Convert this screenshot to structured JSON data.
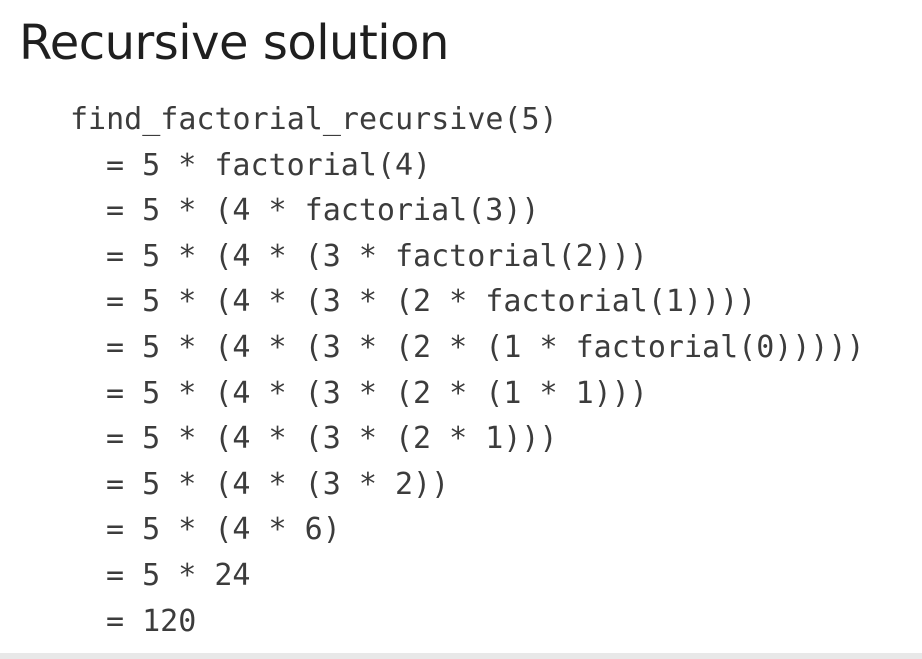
{
  "title": "Recursive solution",
  "code": {
    "call": "find_factorial_recursive(5)",
    "steps": [
      "= 5 * factorial(4)",
      "= 5 * (4 * factorial(3))",
      "= 5 * (4 * (3 * factorial(2)))",
      "= 5 * (4 * (3 * (2 * factorial(1))))",
      "= 5 * (4 * (3 * (2 * (1 * factorial(0)))))",
      "= 5 * (4 * (3 * (2 * (1 * 1)))",
      "= 5 * (4 * (3 * (2 * 1)))",
      "= 5 * (4 * (3 * 2))",
      "= 5 * (4 * 6)",
      "= 5 * 24",
      "= 120"
    ]
  }
}
